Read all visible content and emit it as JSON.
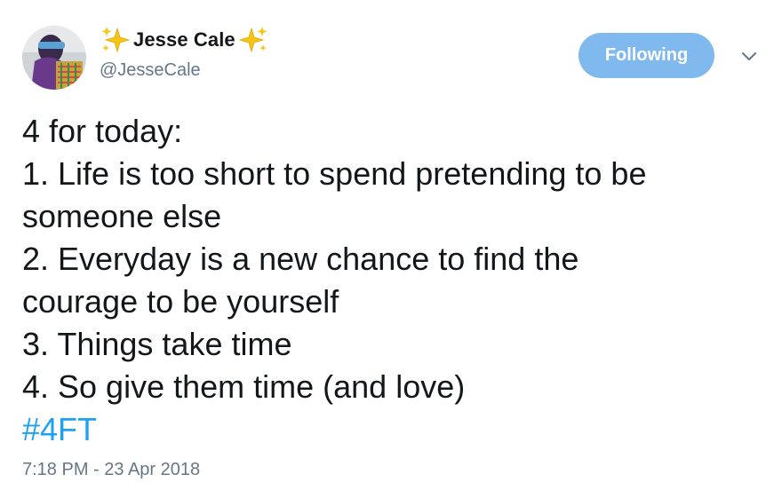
{
  "author": {
    "display_name": "Jesse Cale",
    "handle": "@JesseCale",
    "avatar_icon": "profile-photo"
  },
  "follow_button": {
    "label": "Following"
  },
  "tweet": {
    "lines": [
      "4 for today:",
      "1. Life is too short to spend pretending to be",
      "someone else",
      "2. Everyday is a new chance to find the",
      "courage to be yourself",
      "3. Things take time",
      "4. So give them time (and love)"
    ],
    "hashtag": "#4FT",
    "timestamp": "7:18 PM - 23 Apr 2018"
  },
  "colors": {
    "follow_button": "#7fb9ee",
    "hashtag": "#1da1f2",
    "secondary_text": "#657786",
    "sparkle": "#f5c518"
  }
}
